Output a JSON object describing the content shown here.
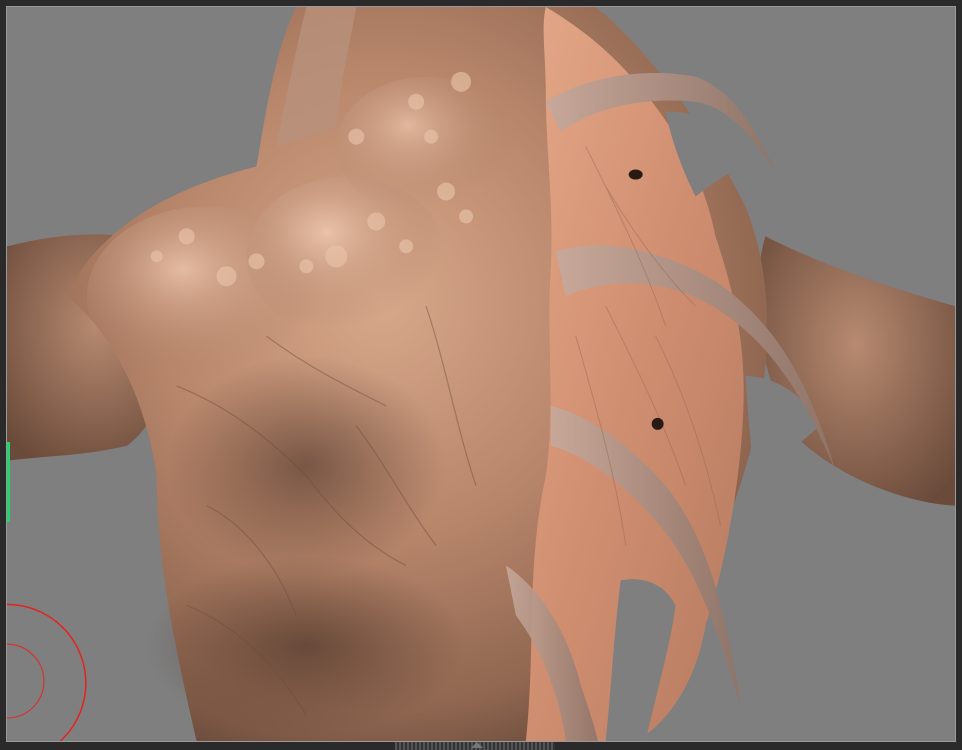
{
  "app": {
    "title": "",
    "viewport_label": ""
  },
  "viewport": {
    "background_color": "#7f7f7f",
    "model": "creature-back-sculpt",
    "accent_marker_color": "#24d36b"
  },
  "brush_cursor": {
    "outer_ring_color": "#e52222",
    "inner_ring_color": "#e52222"
  },
  "icons": {
    "bottom_handle": "resize-grip-icon"
  }
}
